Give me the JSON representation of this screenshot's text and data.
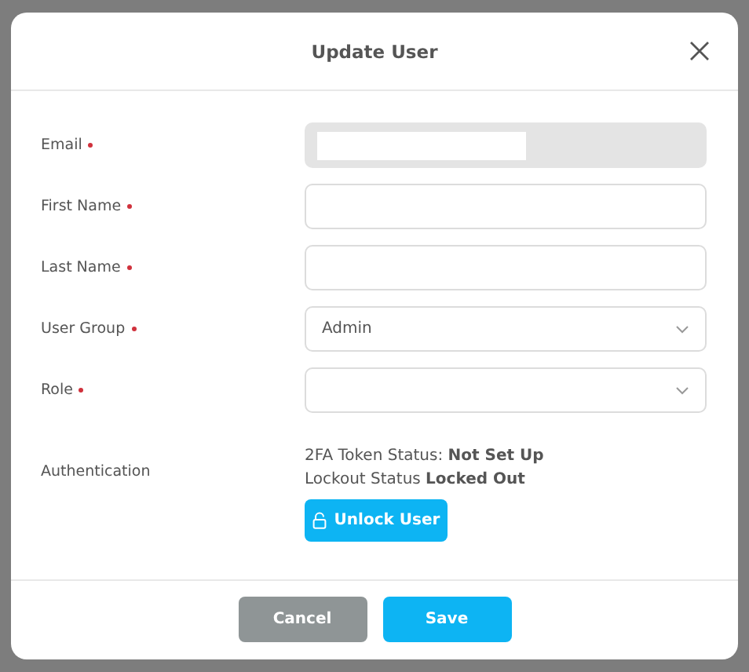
{
  "dialog": {
    "title": "Update User",
    "fields": [
      {
        "label": "Email",
        "required": true,
        "kind": "text",
        "disabled": true,
        "redacted": true
      },
      {
        "label": "First Name",
        "required": true,
        "kind": "text",
        "disabled": false,
        "redacted": false
      },
      {
        "label": "Last Name",
        "required": true,
        "kind": "text",
        "disabled": false,
        "redacted": false
      },
      {
        "label": "User Group",
        "required": true,
        "kind": "select",
        "disabled": false,
        "value": "Admin"
      },
      {
        "label": "Role",
        "required": true,
        "kind": "select",
        "disabled": false
      }
    ],
    "authentication": {
      "label": "Authentication",
      "lines": [
        "2FA Token Status: **Not Set Up**",
        "Lockout Status **Locked Out**"
      ],
      "button": "Unlock User"
    },
    "buttons": [
      {
        "label": "Cancel",
        "kind": "secondary"
      },
      {
        "label": "Save",
        "kind": "primary"
      }
    ]
  }
}
